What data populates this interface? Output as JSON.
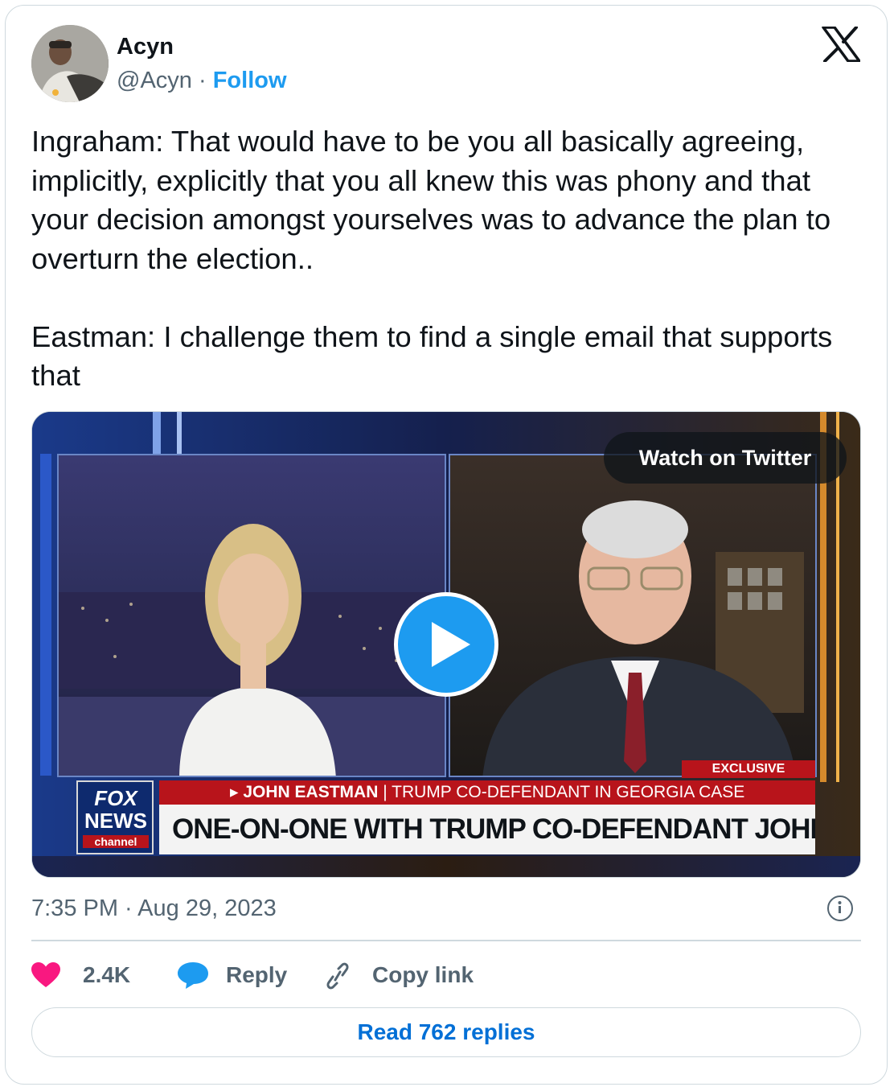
{
  "author": {
    "name": "Acyn",
    "handle": "@Acyn",
    "separator": "·",
    "follow_label": "Follow"
  },
  "tweet": {
    "paragraph1": "Ingraham: That would have to be you all basically agreeing, implicitly, explicitly that you all knew this was phony and that your decision amongst yourselves was to advance the plan to overturn the election..",
    "paragraph2": "Eastman: I challenge them to find a single email that supports that"
  },
  "media": {
    "watch_label": "Watch on Twitter",
    "exclusive_label": "EXCLUSIVE",
    "logo_fox": "FOX",
    "logo_news": "NEWS",
    "logo_channel": "channel",
    "lower_third_name": "▸ JOHN EASTMAN",
    "lower_third_sep": " | ",
    "lower_third_desc": "TRUMP CO-DEFENDANT IN GEORGIA CASE",
    "lower_third_headline": "ONE-ON-ONE WITH TRUMP CO-DEFENDANT JOHN EASTMAN"
  },
  "meta": {
    "timestamp": "7:35 PM · Aug 29, 2023"
  },
  "actions": {
    "likes": "2.4K",
    "reply_label": "Reply",
    "copy_label": "Copy link"
  },
  "read_replies_label": "Read 762 replies",
  "icons": [
    "x-logo-icon",
    "heart-icon",
    "reply-bubble-icon",
    "link-icon",
    "info-icon",
    "play-icon"
  ],
  "colors": {
    "link_blue": "#1d9bf0",
    "heart_pink": "#f91880",
    "read_button_text": "#006fd6",
    "secondary_text": "#536471"
  }
}
